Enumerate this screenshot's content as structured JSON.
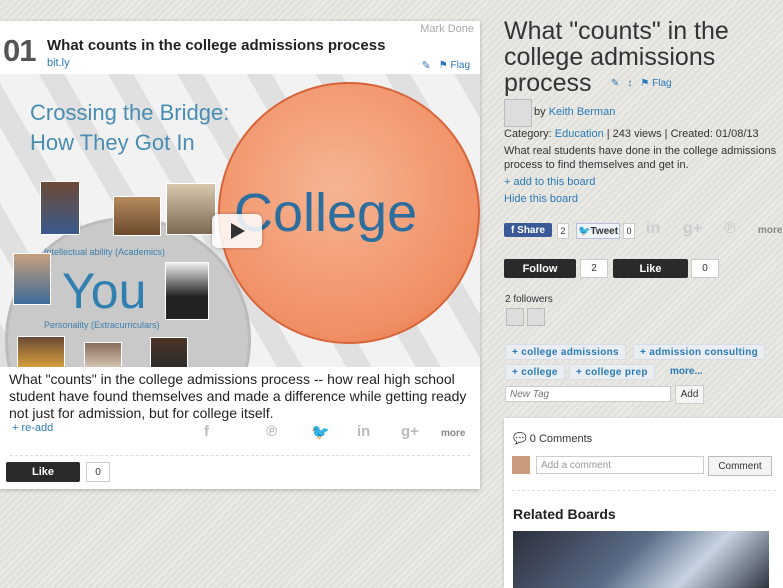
{
  "card": {
    "mark_done": "Mark Done",
    "number": "01",
    "title": "What counts in the college admissions process",
    "source": "bit.ly",
    "flag": "Flag",
    "slide": {
      "heading_line1": "Crossing the Bridge:",
      "heading_line2": "How They Got In",
      "word_college": "College",
      "word_you": "You",
      "label_intellectual": "Intellectual ability (Academics)",
      "label_personality": "Personality (Extracurriculars)"
    },
    "description": "What \"counts\" in the college admissions process -- how real high school student have found themselves and made a difference while getting ready not just for admission, but for college itself.",
    "readd": "+ re-add",
    "more": "more",
    "like_label": "Like",
    "like_count": "0"
  },
  "board": {
    "title": "What \"counts\" in the college admissions process",
    "flag": "Flag",
    "by": "by",
    "author": "Keith Berman",
    "category_label": "Category:",
    "category": "Education",
    "views": "| 243 views | Created: 01/08/13",
    "description": "What real students have done in the college admissions process to find themselves and get in.",
    "add_link": "+ add to this board",
    "hide_link": "Hide this board",
    "share_label": "Share",
    "share_count": "2",
    "tweet_label": "Tweet",
    "tweet_count": "0",
    "more": "more",
    "follow_label": "Follow",
    "follow_count": "2",
    "like_label": "Like",
    "like_count": "0",
    "followers_text": "2 followers",
    "tags": [
      "college admissions",
      "admission consulting",
      "college",
      "college prep"
    ],
    "tags_more": "more...",
    "new_tag_placeholder": "New Tag",
    "add_label": "Add"
  },
  "comments": {
    "header": "0 Comments",
    "placeholder": "Add a comment",
    "button": "Comment",
    "related_header": "Related Boards"
  }
}
